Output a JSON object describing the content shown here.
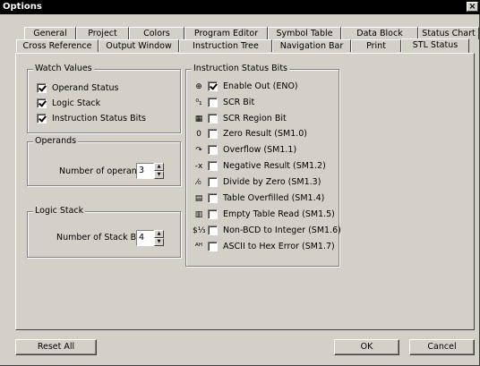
{
  "window": {
    "title": "Options",
    "close_label": "×"
  },
  "tabs_row1": [
    "General",
    "Project",
    "Colors",
    "Program Editor",
    "Symbol Table",
    "Data Block",
    "Status Chart"
  ],
  "tabs_row2": [
    "Cross Reference",
    "Output Window",
    "Instruction Tree",
    "Navigation Bar",
    "Print",
    "STL Status"
  ],
  "active_tab": "STL Status",
  "watch_values": {
    "legend": "Watch Values",
    "items": [
      {
        "label": "Operand Status",
        "checked": true
      },
      {
        "label": "Logic Stack",
        "checked": true
      },
      {
        "label": "Instruction Status Bits",
        "checked": true
      }
    ]
  },
  "operands": {
    "legend": "Operands",
    "label": "Number of operands",
    "value": "3"
  },
  "logic_stack": {
    "legend": "Logic Stack",
    "label": "Number of Stack Bits",
    "value": "4"
  },
  "instruction_status_bits": {
    "legend": "Instruction Status Bits",
    "items": [
      {
        "icon": "enable-out-icon",
        "glyph": "⊕",
        "label": "Enable Out (ENO)",
        "checked": true
      },
      {
        "icon": "scr-bit-icon",
        "glyph": "⁰₁",
        "label": "SCR Bit",
        "checked": false
      },
      {
        "icon": "scr-region-icon",
        "glyph": "▦",
        "label": "SCR Region Bit",
        "checked": false
      },
      {
        "icon": "zero-result-icon",
        "glyph": "0",
        "label": "Zero Result (SM1.0)",
        "checked": false
      },
      {
        "icon": "overflow-icon",
        "glyph": "↷",
        "label": "Overflow (SM1.1)",
        "checked": false
      },
      {
        "icon": "negative-result-icon",
        "glyph": "-x",
        "label": "Negative Result (SM1.2)",
        "checked": false
      },
      {
        "icon": "divide-by-zero-icon",
        "glyph": "⁄₀",
        "label": "Divide by Zero (SM1.3)",
        "checked": false
      },
      {
        "icon": "table-overfilled-icon",
        "glyph": "▤",
        "label": "Table Overfilled (SM1.4)",
        "checked": false
      },
      {
        "icon": "empty-table-icon",
        "glyph": "▥",
        "label": "Empty Table Read (SM1.5)",
        "checked": false
      },
      {
        "icon": "non-bcd-icon",
        "glyph": "$⅓",
        "label": "Non-BCD to Integer (SM1.6)",
        "checked": false
      },
      {
        "icon": "ascii-hex-icon",
        "glyph": "ᴬᴴ",
        "label": "ASCII to Hex Error (SM1.7)",
        "checked": false
      }
    ]
  },
  "buttons": {
    "reset_all": "Reset All",
    "ok": "OK",
    "cancel": "Cancel"
  }
}
